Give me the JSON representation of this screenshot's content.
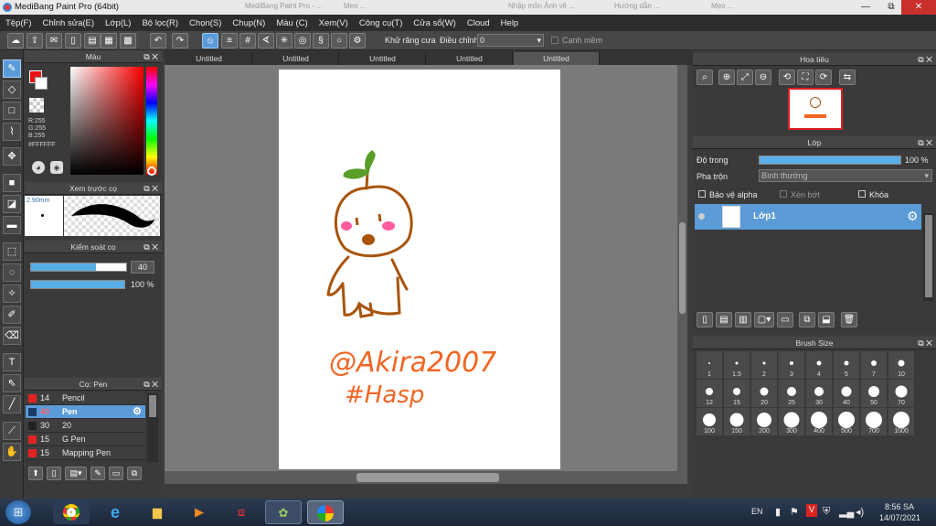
{
  "window": {
    "title": "MediBang Paint Pro (64bit)",
    "bg_tab1": "MediBang Paint Pro - ...",
    "bg_tab2": "Mẹo ...",
    "bg_tab3": "Nhập môn Ảnh vẽ ...",
    "bg_tab4": "Hướng dẫn ...",
    "bg_tab5": "Mẹo ...",
    "controls": [
      "—",
      "⧉",
      "✕"
    ]
  },
  "menu": [
    "Tệp(F)",
    "Chỉnh sửa(E)",
    "Lớp(L)",
    "Bộ lọc(R)",
    "Chọn(S)",
    "Chụp(N)",
    "Màu (C)",
    "Xem(V)",
    "Công cụ(T)",
    "Cửa sổ(W)",
    "Cloud",
    "Help"
  ],
  "toolbar": {
    "antialias_label": "Khử răng cưa",
    "correction_label": "Điều chỉnh",
    "correction_value": "0",
    "edge_label": "Cạnh mềm"
  },
  "color_panel": {
    "title": "Màu",
    "r": "R:255",
    "g": "G:255",
    "b": "B:255",
    "hex": "#FFFFFF"
  },
  "brush_preview": {
    "title": "Xem trước cọ",
    "size": "2.90mm"
  },
  "brush_control": {
    "title": "Kiểm soát cọ",
    "size_value": "40",
    "opacity_value": "100 %",
    "size_fraction": 0.68,
    "opacity_fraction": 1.0
  },
  "brush_list": {
    "title": "Cọ: Pen",
    "items": [
      {
        "num": "14",
        "name": "Pencil",
        "color": "#e52222"
      },
      {
        "num": "40",
        "name": "Pen",
        "color": "#1a3d66",
        "selected": true
      },
      {
        "num": "30",
        "name": "20",
        "color": "#222222"
      },
      {
        "num": "15",
        "name": "G Pen",
        "color": "#e52222"
      },
      {
        "num": "15",
        "name": "Mapping Pen",
        "color": "#e52222"
      }
    ]
  },
  "canvas": {
    "tabs": [
      "Untitled",
      "Untitled",
      "Untitled",
      "Untitled",
      "Untitled"
    ],
    "active_tab": 4
  },
  "navigator": {
    "title": "Hoa tiêu"
  },
  "layer_panel": {
    "title": "Lớp",
    "opacity_label": "Độ trong",
    "opacity_value": "100 %",
    "blend_label": "Pha trộn",
    "blend_value": "Bình thường",
    "protect_alpha": "Bảo vệ alpha",
    "clipping": "Xén bớt",
    "lock": "Khóa",
    "layer_name": "Lớp1"
  },
  "brush_size": {
    "title": "Brush Size",
    "sizes": [
      "1",
      "1.5",
      "2",
      "3",
      "4",
      "5",
      "7",
      "10",
      "12",
      "15",
      "20",
      "25",
      "30",
      "40",
      "50",
      "70",
      "100",
      "150",
      "200",
      "300",
      "400",
      "500",
      "700",
      "1000"
    ]
  },
  "drawing": {
    "text1": "@Akira2007",
    "text2": "#Hasp"
  },
  "taskbar": {
    "lang": "EN",
    "time": "8:56 SA",
    "date": "14/07/2021"
  },
  "colors": {
    "accent": "#5b9bd8",
    "stroke": "#a8540d",
    "text_stroke": "#f26522"
  }
}
